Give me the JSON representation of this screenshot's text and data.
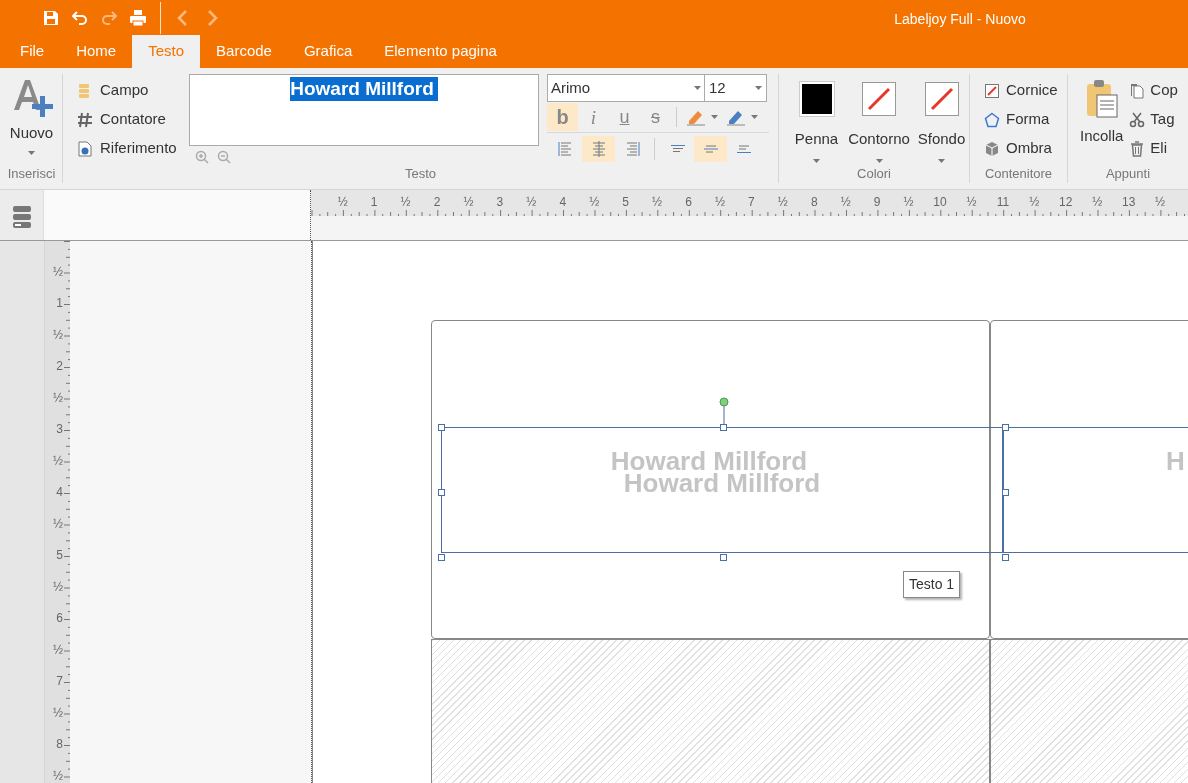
{
  "title_bar": {
    "title": "Labeljoy Full - Nuovo",
    "quick_access": [
      {
        "kind": "save",
        "disabled": false
      },
      {
        "kind": "undo",
        "disabled": false
      },
      {
        "kind": "redo",
        "disabled": true
      },
      {
        "kind": "print",
        "disabled": false
      },
      {
        "kind": "back",
        "disabled": true
      },
      {
        "kind": "forward",
        "disabled": true
      }
    ]
  },
  "ribbon_tabs": [
    {
      "label": "File",
      "selected": false
    },
    {
      "label": "Home",
      "selected": false
    },
    {
      "label": "Testo",
      "selected": true
    },
    {
      "label": "Barcode",
      "selected": false
    },
    {
      "label": "Grafica",
      "selected": false
    },
    {
      "label": "Elemento pagina",
      "selected": false
    }
  ],
  "ribbon": {
    "insert_group": {
      "label": "Inserisci",
      "new_button": "Nuovo"
    },
    "text_group": {
      "label": "Testo",
      "items": [
        {
          "kind": "field",
          "label": "Campo"
        },
        {
          "kind": "counter",
          "label": "Contatore"
        },
        {
          "kind": "reference",
          "label": "Riferimento"
        }
      ],
      "editor_text": "Howard Millford",
      "font": "Arimo",
      "size": "12",
      "format_buttons": [
        {
          "kind": "bold",
          "glyph": "b",
          "selected": true
        },
        {
          "kind": "italic",
          "glyph": "i",
          "selected": false
        },
        {
          "kind": "underline",
          "glyph": "u",
          "selected": false
        },
        {
          "kind": "strike",
          "glyph": "s",
          "selected": false
        }
      ],
      "align_buttons": [
        {
          "kind": "left",
          "selected": false
        },
        {
          "kind": "center",
          "selected": true
        },
        {
          "kind": "right",
          "selected": false
        },
        {
          "kind": "top",
          "selected": false
        },
        {
          "kind": "middle",
          "selected": true
        },
        {
          "kind": "bottom",
          "selected": false
        }
      ]
    },
    "colors_group": {
      "label": "Colori",
      "swatches": [
        {
          "label": "Penna",
          "kind": "solid",
          "color": "#000000"
        },
        {
          "label": "Contorno",
          "kind": "none"
        },
        {
          "label": "Sfondo",
          "kind": "none"
        }
      ]
    },
    "container_group": {
      "label": "Contenitore",
      "items": [
        {
          "kind": "frame",
          "label": "Cornice"
        },
        {
          "kind": "shape",
          "label": "Forma"
        },
        {
          "kind": "shadow",
          "label": "Ombra"
        }
      ]
    },
    "clipboard_group": {
      "label": "Appunti",
      "paste_button": "Incolla",
      "items": [
        {
          "kind": "copy",
          "label": "Cop"
        },
        {
          "kind": "cut",
          "label": "Tag"
        },
        {
          "kind": "delete",
          "label": "Eli"
        }
      ]
    }
  },
  "rulers": {
    "horizontal": [
      "½",
      "1",
      "½",
      "2",
      "½",
      "3",
      "½",
      "4",
      "½",
      "5",
      "½",
      "6",
      "½",
      "7",
      "½",
      "8",
      "½",
      "9",
      "½",
      "10",
      "½",
      "11",
      "½",
      "12",
      "½",
      "13",
      "½"
    ],
    "vertical": [
      "½",
      "1",
      "½",
      "2",
      "½",
      "3",
      "½",
      "4",
      "½",
      "5",
      "½",
      "6",
      "½",
      "7",
      "½",
      "8",
      "½"
    ]
  },
  "canvas": {
    "labels": [
      {
        "kind": "label",
        "texts": [
          "Howard Millford",
          "Howard Millford"
        ]
      },
      {
        "kind": "label",
        "texts": [
          "H"
        ]
      },
      {
        "kind": "empty"
      },
      {
        "kind": "empty"
      }
    ],
    "tooltip": "Testo 1"
  }
}
